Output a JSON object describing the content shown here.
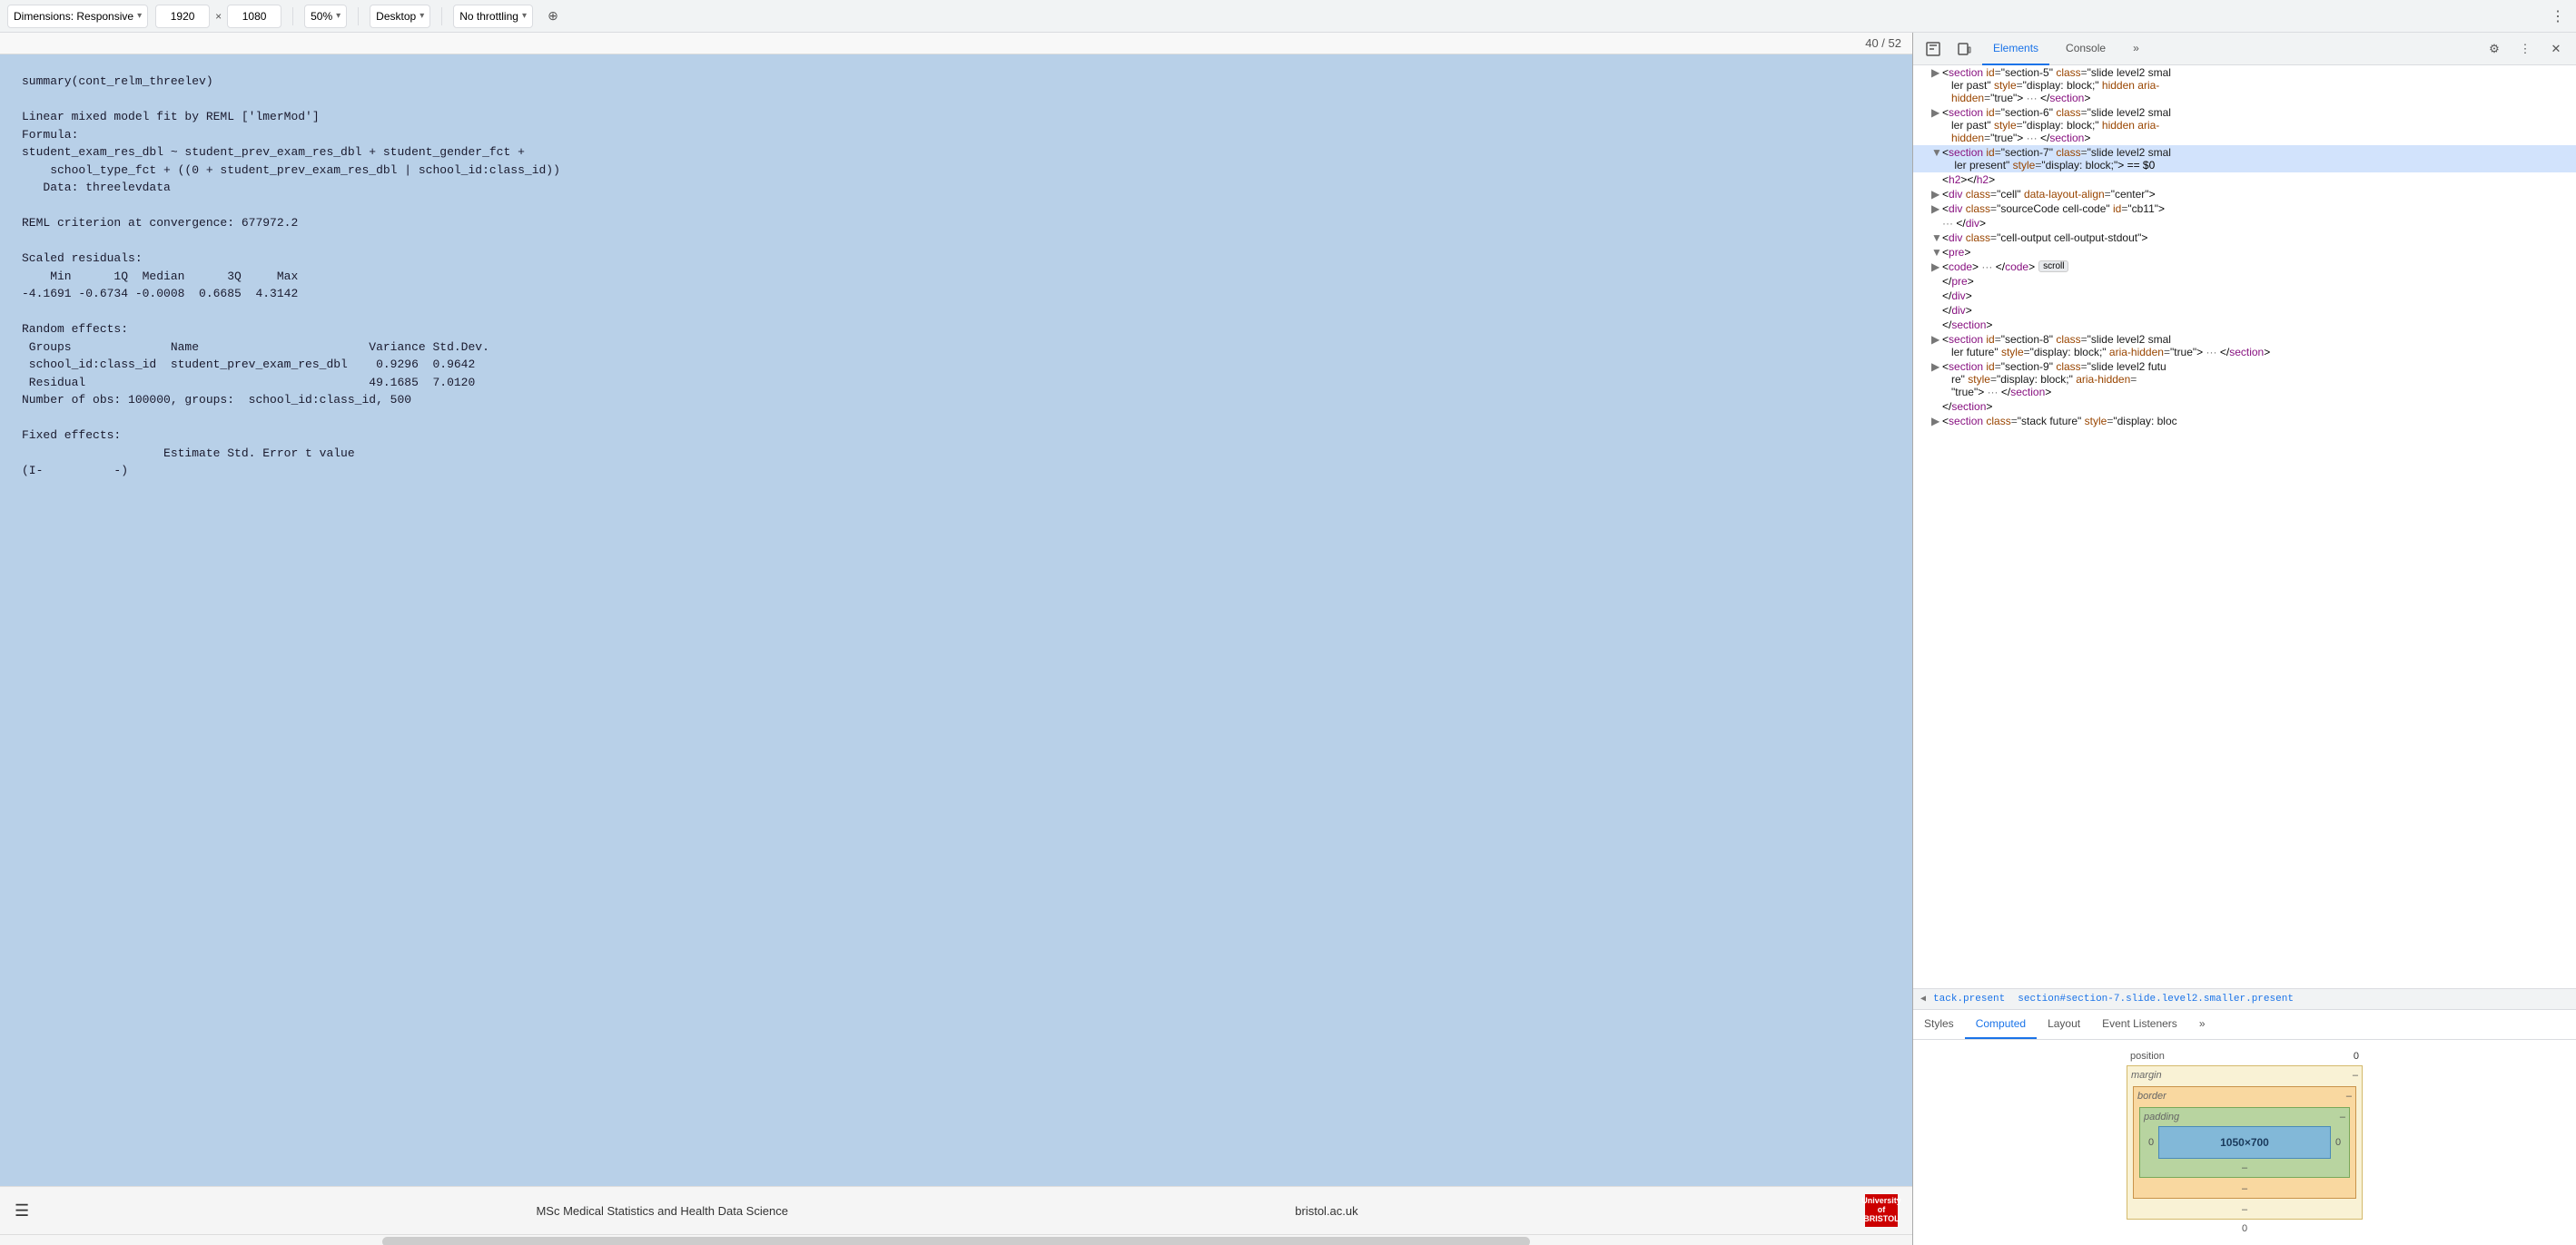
{
  "toolbar": {
    "dimensions_label": "Dimensions: Responsive",
    "width_value": "1920",
    "height_value": "1080",
    "zoom_label": "50%",
    "device_label": "Desktop",
    "throttle_label": "No throttling",
    "chevron": "▾"
  },
  "slide": {
    "counter": "40 / 52",
    "content_lines": [
      "summary(cont_relm_threelev)",
      "",
      "Linear mixed model fit by REML ['lmerMod']",
      "Formula:",
      "student_exam_res_dbl ~ student_prev_exam_res_dbl + student_gender_fct +",
      "    school_type_fct + ((0 + student_prev_exam_res_dbl | school_id:class_id))",
      "   Data: threelevdata",
      "",
      "REML criterion at convergence: 677972.2",
      "",
      "Scaled residuals:",
      "    Min      1Q  Median      3Q     Max",
      "-4.1691 -0.6734 -0.0008  0.6685  4.3142",
      "",
      "Random effects:",
      " Groups              Name                        Variance Std.Dev.",
      " school_id:class_id  student_prev_exam_res_dbl    0.9296  0.9642",
      " Residual                                        49.1685  7.0120",
      "Number of obs: 100000, groups:  school_id:class_id, 500",
      "",
      "Fixed effects:",
      "                    Estimate Std. Error t value",
      "(I...          ...)"
    ]
  },
  "footer": {
    "menu_icon": "☰",
    "center_text": "MSc Medical Statistics and Health Data Science",
    "right_text": "bristol.ac.uk",
    "logo_line1": "University of",
    "logo_line2": "BRISTOL"
  },
  "devtools": {
    "tabs": [
      "Elements",
      "Console",
      "»"
    ],
    "active_tab": "Elements",
    "settings_icon": "⚙",
    "close_icon": "✕",
    "more_icon": "⋮",
    "inspect_icon": "⬚",
    "device_icon": "☐"
  },
  "html_tree": {
    "lines": [
      {
        "indent": 2,
        "toggle": "▶",
        "html": "<section id=\"section-5\" class=\"slide level2 smal\nler past\" style=\"display: block;\" hidden aria-\nhidden=\"true\"> ··· </section>"
      },
      {
        "indent": 2,
        "toggle": "▶",
        "html": "<section id=\"section-6\" class=\"slide level2 smal\nler past\" style=\"display: block;\" hidden aria-\nhidden=\"true\"> ··· </section>"
      },
      {
        "indent": 2,
        "toggle": "▼",
        "html": "<section id=\"section-7\" class=\"slide level2 smal\nler present\" style=\"display: block;\"> == $0"
      },
      {
        "indent": 3,
        "toggle": " ",
        "html": "<h2></h2>"
      },
      {
        "indent": 3,
        "toggle": "▶",
        "html": "<div class=\"cell\" data-layout-align=\"center\">"
      },
      {
        "indent": 4,
        "toggle": "▶",
        "html": "<div class=\"sourceCode cell-code\" id=\"cb11\">"
      },
      {
        "indent": 5,
        "toggle": " ",
        "html": "··· </div>"
      },
      {
        "indent": 4,
        "toggle": "▼",
        "html": "<div class=\"cell-output cell-output-stdout\">"
      },
      {
        "indent": 5,
        "toggle": "▼",
        "html": "<pre>"
      },
      {
        "indent": 6,
        "toggle": "▶",
        "html": "<code> ··· </code>",
        "badge": "scroll"
      },
      {
        "indent": 5,
        "toggle": " ",
        "html": "</pre>"
      },
      {
        "indent": 4,
        "toggle": " ",
        "html": "</div>"
      },
      {
        "indent": 3,
        "toggle": " ",
        "html": "</div>"
      },
      {
        "indent": 2,
        "toggle": " ",
        "html": "</section>"
      },
      {
        "indent": 2,
        "toggle": "▶",
        "html": "<section id=\"section-8\" class=\"slide level2 smal\nler future\" style=\"display: block;\" aria-hidden=\"true\"> ··· </section>"
      },
      {
        "indent": 2,
        "toggle": "▶",
        "html": "<section id=\"section-9\" class=\"slide level2 futu\nre\" style=\"display: block;\" aria-hidden=\n\"true\"> ··· </section>"
      },
      {
        "indent": 1,
        "toggle": " ",
        "html": "</section>"
      },
      {
        "indent": 1,
        "toggle": "▶",
        "html": "<section class=\"stack future\" style=\"display: bloc"
      }
    ]
  },
  "breadcrumb": {
    "arrow": "◀",
    "items": [
      "tack.present",
      "section#section-7.slide.level2.smaller.present"
    ]
  },
  "styles_tabs": {
    "tabs": [
      "Styles",
      "Computed",
      "Layout",
      "Event Listeners",
      "»"
    ],
    "active_tab": "Computed"
  },
  "box_model": {
    "position_label": "position",
    "position_value": "0",
    "margin_label": "margin",
    "margin_value": "–",
    "border_label": "border",
    "border_value": "–",
    "padding_label": "padding",
    "padding_value": "–",
    "content_value": "1050×700",
    "left_value": "0",
    "right_value": "0",
    "top_value": "–",
    "bottom_value": "–",
    "outer_top": "0",
    "outer_bottom": "0",
    "outer_left": "0",
    "outer_right": "0"
  }
}
